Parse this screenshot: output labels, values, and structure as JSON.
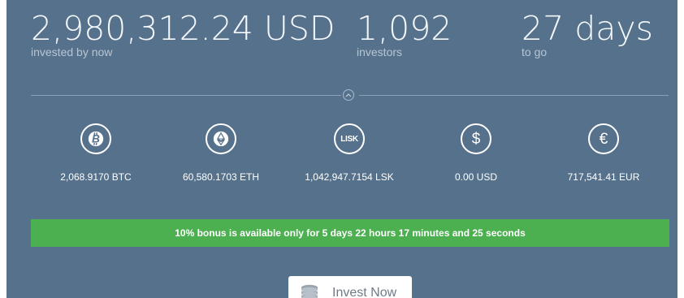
{
  "stats": {
    "invested": {
      "value": "2,980,312.24 USD",
      "label": "invested by now"
    },
    "investors": {
      "value": "1,092",
      "label": "investors"
    },
    "days": {
      "value": "27 days",
      "label": "to go"
    }
  },
  "currencies": [
    {
      "icon": "bitcoin-icon",
      "symbol": "BTC",
      "amount": "2,068.9170 BTC"
    },
    {
      "icon": "ethereum-icon",
      "symbol": "ETH",
      "amount": "60,580.1703 ETH"
    },
    {
      "icon": "lisk-icon",
      "symbol": "LISK",
      "amount": "1,042,947.7154 LSK"
    },
    {
      "icon": "dollar-icon",
      "symbol": "$",
      "amount": "0.00 USD"
    },
    {
      "icon": "euro-icon",
      "symbol": "€",
      "amount": "717,541.41 EUR"
    }
  ],
  "lisk_badge": "LISK",
  "dollar_glyph": "$",
  "euro_glyph": "€",
  "bonus_text": "10% bonus is available only for 5 days 22 hours 17 minutes and 25 seconds",
  "invest_button": {
    "label": "Invest Now",
    "icon": "coins-icon"
  },
  "colors": {
    "panel_bg": "#56718b",
    "bonus_bg": "#4caf50",
    "text_primary": "#ffffff",
    "text_secondary": "#b7c6d4"
  }
}
